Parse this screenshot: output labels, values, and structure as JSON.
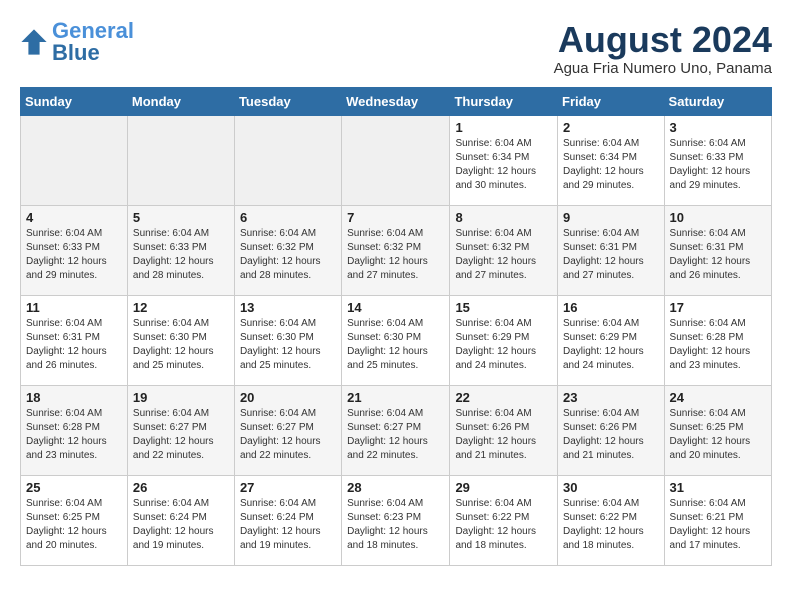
{
  "header": {
    "logo_general": "General",
    "logo_blue": "Blue",
    "month_title": "August 2024",
    "location": "Agua Fria Numero Uno, Panama"
  },
  "days_of_week": [
    "Sunday",
    "Monday",
    "Tuesday",
    "Wednesday",
    "Thursday",
    "Friday",
    "Saturday"
  ],
  "weeks": [
    [
      {
        "day": "",
        "info": ""
      },
      {
        "day": "",
        "info": ""
      },
      {
        "day": "",
        "info": ""
      },
      {
        "day": "",
        "info": ""
      },
      {
        "day": "1",
        "info": "Sunrise: 6:04 AM\nSunset: 6:34 PM\nDaylight: 12 hours\nand 30 minutes."
      },
      {
        "day": "2",
        "info": "Sunrise: 6:04 AM\nSunset: 6:34 PM\nDaylight: 12 hours\nand 29 minutes."
      },
      {
        "day": "3",
        "info": "Sunrise: 6:04 AM\nSunset: 6:33 PM\nDaylight: 12 hours\nand 29 minutes."
      }
    ],
    [
      {
        "day": "4",
        "info": "Sunrise: 6:04 AM\nSunset: 6:33 PM\nDaylight: 12 hours\nand 29 minutes."
      },
      {
        "day": "5",
        "info": "Sunrise: 6:04 AM\nSunset: 6:33 PM\nDaylight: 12 hours\nand 28 minutes."
      },
      {
        "day": "6",
        "info": "Sunrise: 6:04 AM\nSunset: 6:32 PM\nDaylight: 12 hours\nand 28 minutes."
      },
      {
        "day": "7",
        "info": "Sunrise: 6:04 AM\nSunset: 6:32 PM\nDaylight: 12 hours\nand 27 minutes."
      },
      {
        "day": "8",
        "info": "Sunrise: 6:04 AM\nSunset: 6:32 PM\nDaylight: 12 hours\nand 27 minutes."
      },
      {
        "day": "9",
        "info": "Sunrise: 6:04 AM\nSunset: 6:31 PM\nDaylight: 12 hours\nand 27 minutes."
      },
      {
        "day": "10",
        "info": "Sunrise: 6:04 AM\nSunset: 6:31 PM\nDaylight: 12 hours\nand 26 minutes."
      }
    ],
    [
      {
        "day": "11",
        "info": "Sunrise: 6:04 AM\nSunset: 6:31 PM\nDaylight: 12 hours\nand 26 minutes."
      },
      {
        "day": "12",
        "info": "Sunrise: 6:04 AM\nSunset: 6:30 PM\nDaylight: 12 hours\nand 25 minutes."
      },
      {
        "day": "13",
        "info": "Sunrise: 6:04 AM\nSunset: 6:30 PM\nDaylight: 12 hours\nand 25 minutes."
      },
      {
        "day": "14",
        "info": "Sunrise: 6:04 AM\nSunset: 6:30 PM\nDaylight: 12 hours\nand 25 minutes."
      },
      {
        "day": "15",
        "info": "Sunrise: 6:04 AM\nSunset: 6:29 PM\nDaylight: 12 hours\nand 24 minutes."
      },
      {
        "day": "16",
        "info": "Sunrise: 6:04 AM\nSunset: 6:29 PM\nDaylight: 12 hours\nand 24 minutes."
      },
      {
        "day": "17",
        "info": "Sunrise: 6:04 AM\nSunset: 6:28 PM\nDaylight: 12 hours\nand 23 minutes."
      }
    ],
    [
      {
        "day": "18",
        "info": "Sunrise: 6:04 AM\nSunset: 6:28 PM\nDaylight: 12 hours\nand 23 minutes."
      },
      {
        "day": "19",
        "info": "Sunrise: 6:04 AM\nSunset: 6:27 PM\nDaylight: 12 hours\nand 22 minutes."
      },
      {
        "day": "20",
        "info": "Sunrise: 6:04 AM\nSunset: 6:27 PM\nDaylight: 12 hours\nand 22 minutes."
      },
      {
        "day": "21",
        "info": "Sunrise: 6:04 AM\nSunset: 6:27 PM\nDaylight: 12 hours\nand 22 minutes."
      },
      {
        "day": "22",
        "info": "Sunrise: 6:04 AM\nSunset: 6:26 PM\nDaylight: 12 hours\nand 21 minutes."
      },
      {
        "day": "23",
        "info": "Sunrise: 6:04 AM\nSunset: 6:26 PM\nDaylight: 12 hours\nand 21 minutes."
      },
      {
        "day": "24",
        "info": "Sunrise: 6:04 AM\nSunset: 6:25 PM\nDaylight: 12 hours\nand 20 minutes."
      }
    ],
    [
      {
        "day": "25",
        "info": "Sunrise: 6:04 AM\nSunset: 6:25 PM\nDaylight: 12 hours\nand 20 minutes."
      },
      {
        "day": "26",
        "info": "Sunrise: 6:04 AM\nSunset: 6:24 PM\nDaylight: 12 hours\nand 19 minutes."
      },
      {
        "day": "27",
        "info": "Sunrise: 6:04 AM\nSunset: 6:24 PM\nDaylight: 12 hours\nand 19 minutes."
      },
      {
        "day": "28",
        "info": "Sunrise: 6:04 AM\nSunset: 6:23 PM\nDaylight: 12 hours\nand 18 minutes."
      },
      {
        "day": "29",
        "info": "Sunrise: 6:04 AM\nSunset: 6:22 PM\nDaylight: 12 hours\nand 18 minutes."
      },
      {
        "day": "30",
        "info": "Sunrise: 6:04 AM\nSunset: 6:22 PM\nDaylight: 12 hours\nand 18 minutes."
      },
      {
        "day": "31",
        "info": "Sunrise: 6:04 AM\nSunset: 6:21 PM\nDaylight: 12 hours\nand 17 minutes."
      }
    ]
  ]
}
